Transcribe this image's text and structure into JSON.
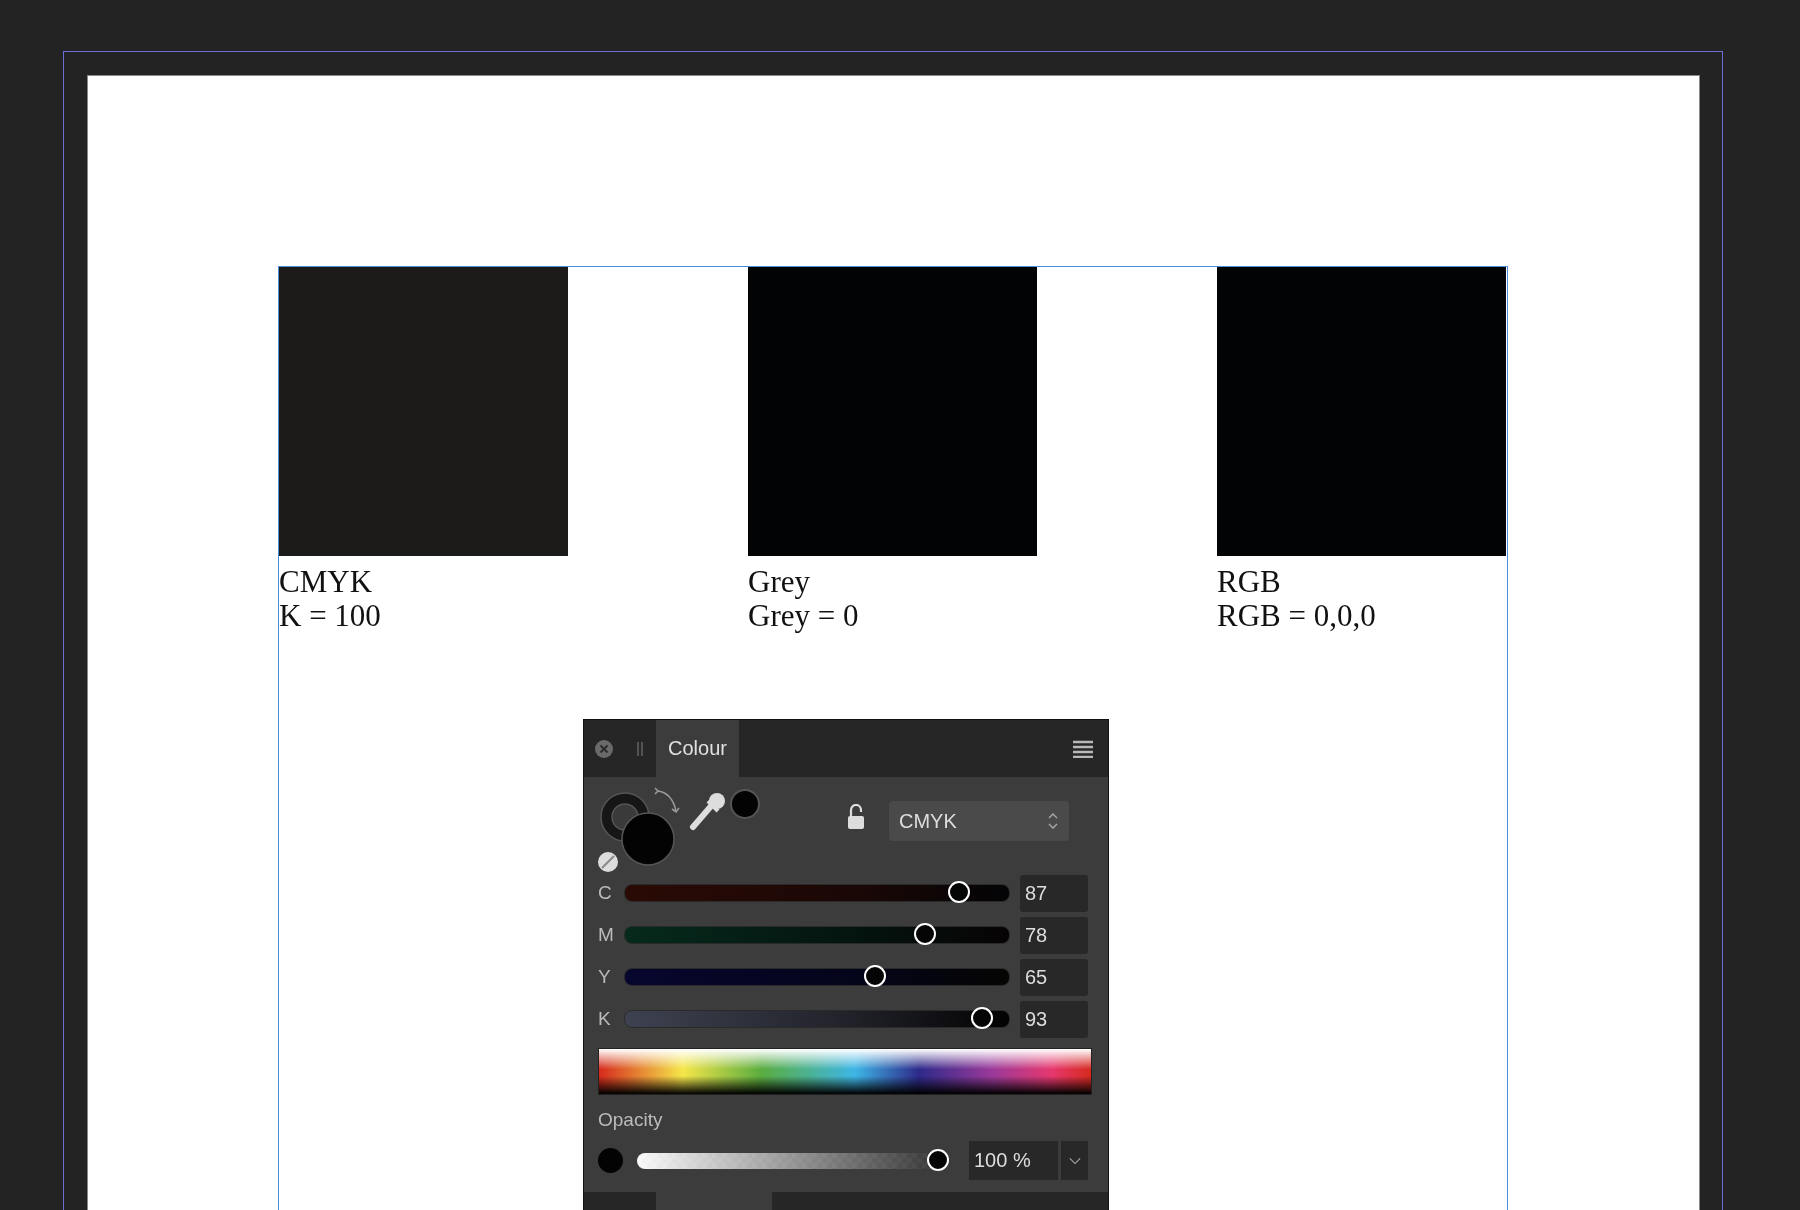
{
  "swatches": [
    {
      "name": "CMYK",
      "value": "K = 100",
      "color": "#1c1b19"
    },
    {
      "name": "Grey",
      "value": "Grey = 0",
      "color": "#020304"
    },
    {
      "name": "RGB",
      "value": "RGB = 0,0,0",
      "color": "#020304"
    }
  ],
  "panel": {
    "tabs": [
      {
        "label": "Colour",
        "selected": true
      }
    ],
    "color_model": "CMYK",
    "channels": [
      {
        "label": "C",
        "level": 0.87,
        "reading": "87"
      },
      {
        "label": "M",
        "level": 0.78,
        "reading": "78"
      },
      {
        "label": "Y",
        "level": 0.65,
        "reading": "65"
      },
      {
        "label": "K",
        "level": 0.93,
        "reading": "93"
      }
    ],
    "opacity": {
      "label": "Opacity",
      "level": 1.0,
      "reading": "100 %"
    }
  }
}
